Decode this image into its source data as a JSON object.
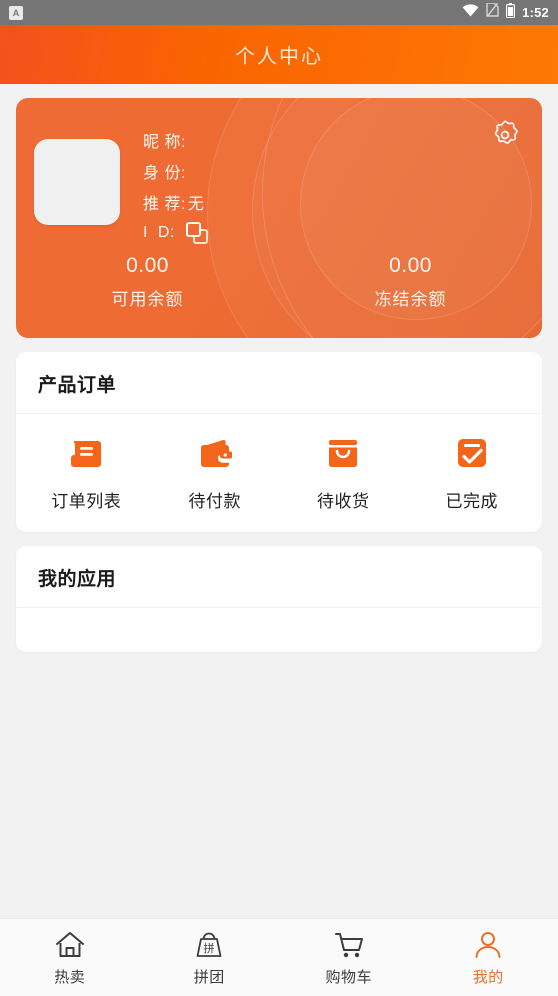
{
  "statusbar": {
    "app_badge": "A",
    "time": "1:52",
    "icons": [
      "wifi-icon",
      "sim-off-icon",
      "battery-icon"
    ]
  },
  "header": {
    "title": "个人中心"
  },
  "profile": {
    "avatar_placeholder": "",
    "settings_icon": "gear-icon",
    "rows": [
      {
        "label": "昵 称:",
        "value": ""
      },
      {
        "label": "身 份:",
        "value": ""
      },
      {
        "label": "推 荐:",
        "value": "无"
      },
      {
        "label": "I  D:",
        "value": "",
        "icon": "copy-icon"
      }
    ],
    "balances": [
      {
        "amount": "0.00",
        "label": "可用余额"
      },
      {
        "amount": "0.00",
        "label": "冻结余额"
      }
    ],
    "colors": {
      "card_start": "#ef6b35",
      "card_end": "#e8642c"
    }
  },
  "orders": {
    "title": "产品订单",
    "items": [
      {
        "label": "订单列表",
        "icon": "order-list-icon"
      },
      {
        "label": "待付款",
        "icon": "wallet-icon"
      },
      {
        "label": "待收货",
        "icon": "shopping-bag-icon"
      },
      {
        "label": "已完成",
        "icon": "clipboard-check-icon"
      }
    ],
    "icon_color": "#f4641b"
  },
  "apps": {
    "title": "我的应用",
    "items": []
  },
  "tabbar": {
    "active_color": "#e8722a",
    "inactive_color": "#3c3c3c",
    "items": [
      {
        "label": "热卖",
        "icon": "home-icon",
        "active": false
      },
      {
        "label": "拼团",
        "icon": "group-buy-bag-icon",
        "active": false
      },
      {
        "label": "购物车",
        "icon": "shopping-cart-icon",
        "active": false
      },
      {
        "label": "我的",
        "icon": "user-icon",
        "active": true
      }
    ]
  }
}
